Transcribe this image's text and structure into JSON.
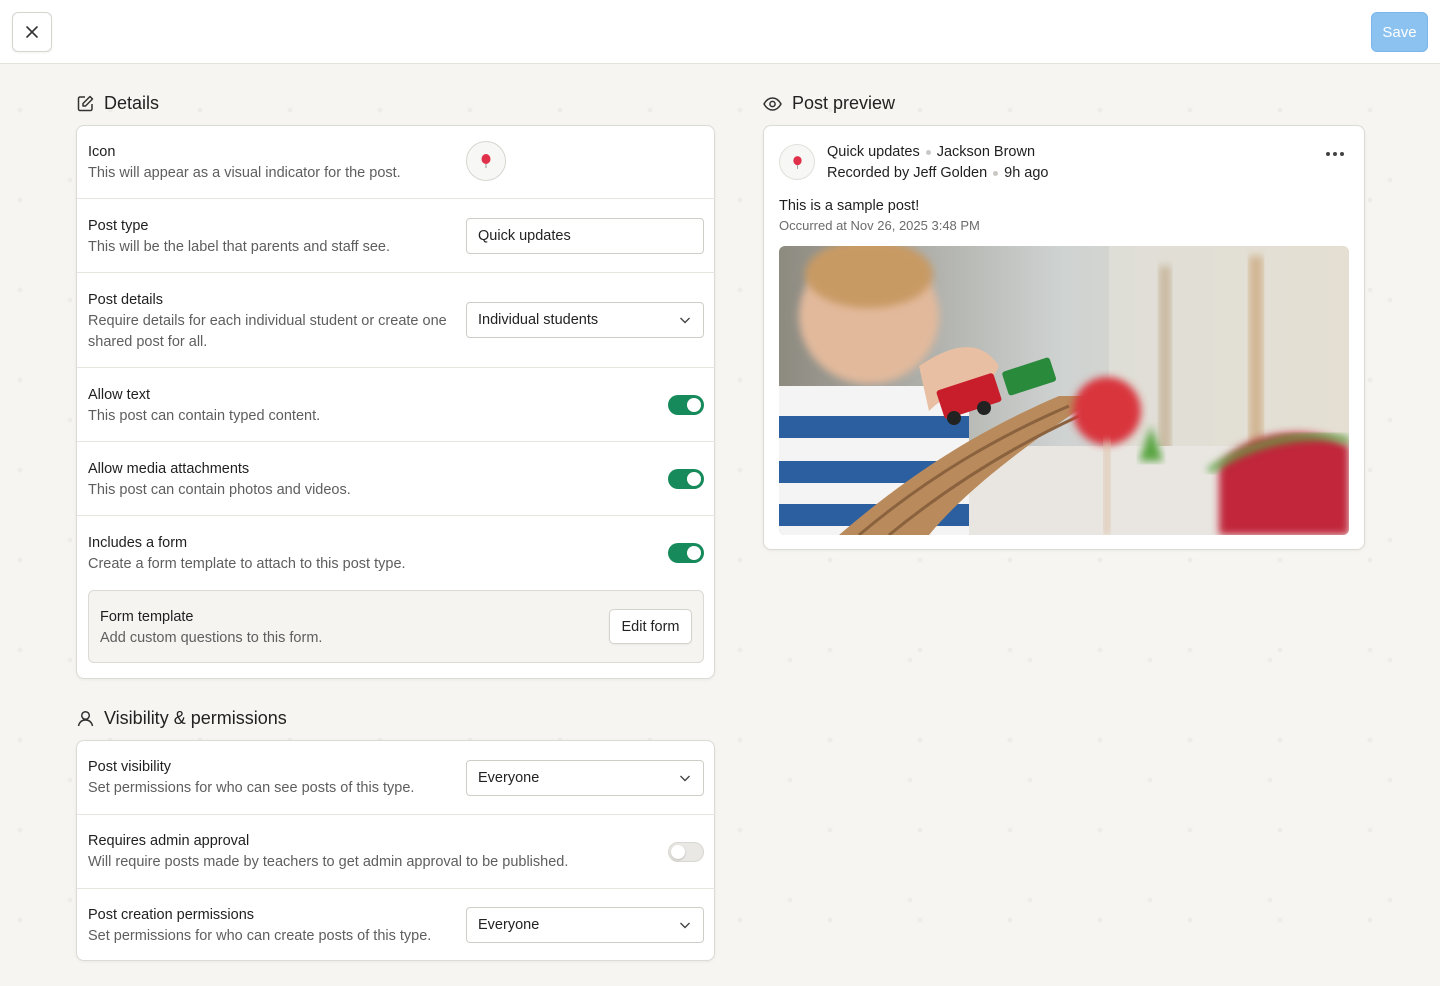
{
  "toolbar": {
    "save_label": "Save"
  },
  "details": {
    "title": "Details",
    "icon_row": {
      "label": "Icon",
      "desc": "This will appear as a visual indicator for the post."
    },
    "post_type": {
      "label": "Post type",
      "desc": "This will be the label that parents and staff see.",
      "value": "Quick updates"
    },
    "post_details": {
      "label": "Post details",
      "desc": "Require details for each individual student or create one shared post for all.",
      "value": "Individual students"
    },
    "allow_text": {
      "label": "Allow text",
      "desc": "This post can contain typed content.",
      "enabled": true
    },
    "allow_media": {
      "label": "Allow media attachments",
      "desc": "This post can contain photos and videos.",
      "enabled": true
    },
    "includes_form": {
      "label": "Includes a form",
      "desc": "Create a form template to attach to this post type.",
      "enabled": true
    },
    "form_template": {
      "label": "Form template",
      "desc": "Add custom questions to this form.",
      "button": "Edit form"
    }
  },
  "visibility": {
    "title": "Visibility & permissions",
    "post_visibility": {
      "label": "Post visibility",
      "desc": "Set permissions for who can see posts of this type.",
      "value": "Everyone"
    },
    "admin_approval": {
      "label": "Requires admin approval",
      "desc": "Will require posts made by teachers to get admin approval to be published.",
      "enabled": false
    },
    "creation_permissions": {
      "label": "Post creation permissions",
      "desc": "Set permissions for who can create posts of this type.",
      "value": "Everyone"
    }
  },
  "preview": {
    "title": "Post preview",
    "post_type": "Quick updates",
    "student": "Jackson Brown",
    "recorded_by": "Recorded by Jeff Golden",
    "time_ago": "9h ago",
    "body": "This is a sample post!",
    "occurred": "Occurred at Nov 26, 2025 3:48 PM"
  },
  "colors": {
    "accent": "#168a5a",
    "save": "#8cc2f0",
    "balloon": "#e0304a"
  }
}
